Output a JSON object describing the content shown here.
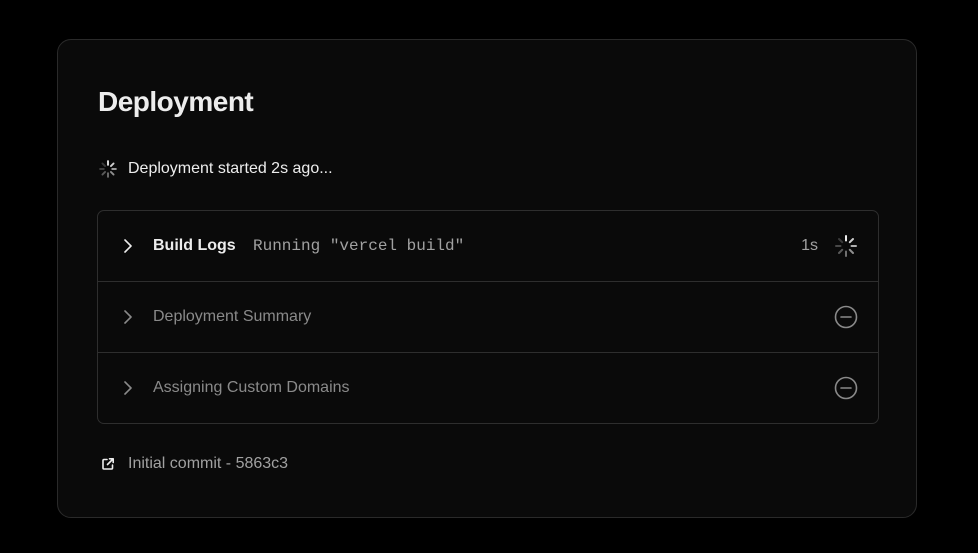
{
  "deployment": {
    "title": "Deployment",
    "status_text": "Deployment started 2s ago...",
    "status_icon": "spinner-icon"
  },
  "steps": [
    {
      "label": "Build Logs",
      "detail": "Running \"vercel build\"",
      "duration": "1s",
      "state": "running",
      "status_icon": "spinner-icon"
    },
    {
      "label": "Deployment Summary",
      "detail": "",
      "duration": "",
      "state": "pending",
      "status_icon": "minus-circle-icon"
    },
    {
      "label": "Assigning Custom Domains",
      "detail": "",
      "duration": "",
      "state": "pending",
      "status_icon": "minus-circle-icon"
    }
  ],
  "commit": {
    "text": "Initial commit - 5863c3",
    "icon": "external-link-icon"
  },
  "colors": {
    "background": "#000000",
    "card": "#0a0a0a",
    "border": "#2e2e2e",
    "text_primary": "#ededed",
    "text_secondary": "#a1a1a1",
    "text_muted": "#8a8a8a"
  }
}
